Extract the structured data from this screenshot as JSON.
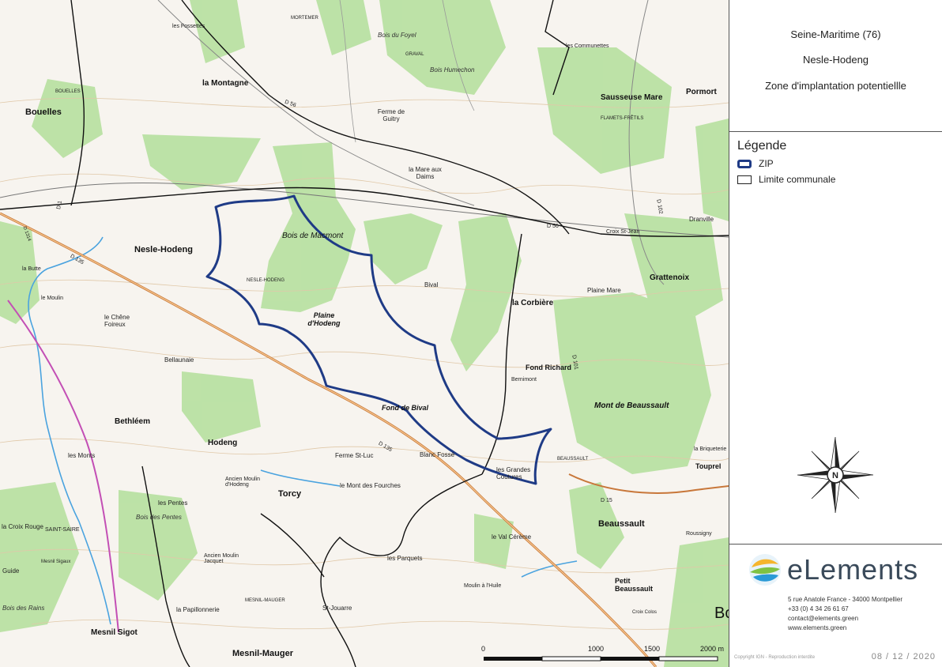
{
  "header": {
    "department": "Seine-Maritime (76)",
    "commune": "Nesle-Hodeng",
    "zone": "Zone d'implantation potentiellle"
  },
  "legend": {
    "title": "Légende",
    "items": [
      {
        "label": "ZIP",
        "color": "#1f3b86"
      },
      {
        "label": "Limite communale",
        "color": "#222222"
      }
    ]
  },
  "brand": {
    "name": "eLements",
    "address": "5 rue Anatole France - 34000 Montpellier",
    "phone": "+33 (0) 4 34 26 61 67",
    "email": "contact@elements.green",
    "website": "www.elements.green",
    "copyright": "Copyright IGN - Reproduction interdite",
    "date": "08 / 12 / 2020"
  },
  "compass": {
    "north": "N"
  },
  "scale": {
    "labels": [
      "0",
      "1000",
      "1500",
      "2000 m"
    ]
  },
  "map": {
    "places_bold": [
      {
        "name": "Bouelles"
      },
      {
        "name": "Nesle-Hodeng"
      },
      {
        "name": "la Montagne"
      },
      {
        "name": "Bethléem"
      },
      {
        "name": "Hodeng"
      },
      {
        "name": "Torcy"
      },
      {
        "name": "Beaussault"
      },
      {
        "name": "Mesnil-Mauger"
      },
      {
        "name": "Mesnil Sigot"
      },
      {
        "name": "Grattenoix"
      },
      {
        "name": "la Corbière"
      },
      {
        "name": "Fond Richard"
      },
      {
        "name": "Sausseuse Mare"
      },
      {
        "name": "Pormort"
      },
      {
        "name": "Petit Beaussault"
      }
    ],
    "places_italic": [
      {
        "name": "Bois de Macmont"
      },
      {
        "name": "Plaine d'Hodeng"
      },
      {
        "name": "Fond de Bival"
      },
      {
        "name": "Mont de Beaussault"
      },
      {
        "name": "Bois Humechon"
      },
      {
        "name": "Bois du Foyel"
      },
      {
        "name": "Bois des Pentes"
      },
      {
        "name": "Bois des Rains"
      }
    ],
    "places_small": [
      {
        "name": "Ferme de Guitry"
      },
      {
        "name": "la Mare aux Daims"
      },
      {
        "name": "Bival"
      },
      {
        "name": "Plaine Mare"
      },
      {
        "name": "Bellaunaie"
      },
      {
        "name": "le Chêne Foireux"
      },
      {
        "name": "Blanc Fossé"
      },
      {
        "name": "les Grandes Coutures"
      },
      {
        "name": "Ferme St-Luc"
      },
      {
        "name": "le Mont des Fourches"
      },
      {
        "name": "Ancien Moulin d'Hodeng"
      },
      {
        "name": "les Pentes"
      },
      {
        "name": "la Croix Rouge"
      },
      {
        "name": "SAINT-SAIRE"
      },
      {
        "name": "les Parquets"
      },
      {
        "name": "le Val Cérème"
      },
      {
        "name": "Moulin à l'Huile"
      },
      {
        "name": "St-Jouarre"
      },
      {
        "name": "la Papillonnerie"
      },
      {
        "name": "les Monts"
      },
      {
        "name": "Dranville"
      },
      {
        "name": "Croix St-Jean"
      },
      {
        "name": "Bernimont"
      },
      {
        "name": "BEAUSSAULT"
      },
      {
        "name": "GRAVAL"
      },
      {
        "name": "MORTEMER"
      },
      {
        "name": "NESLE-HODENG"
      },
      {
        "name": "les Communettes"
      },
      {
        "name": "FLAMETS-FRÊTILS"
      },
      {
        "name": "Roussigny"
      },
      {
        "name": "la Briqueterie"
      },
      {
        "name": "Touprel"
      },
      {
        "name": "Croix Colos"
      },
      {
        "name": "Mesnil Sigaux"
      },
      {
        "name": "Guide"
      },
      {
        "name": "Ancien Moulin Jacquet"
      },
      {
        "name": "MESNIL-MAUGER"
      },
      {
        "name": "la Butte"
      },
      {
        "name": "le Moulin"
      },
      {
        "name": "les Fossettes"
      },
      {
        "name": "BOUELLES"
      },
      {
        "name": "Bo"
      }
    ],
    "roads": [
      "D 56",
      "D 135",
      "D 1",
      "D 1314",
      "D 101",
      "D 102",
      "D 15"
    ]
  }
}
